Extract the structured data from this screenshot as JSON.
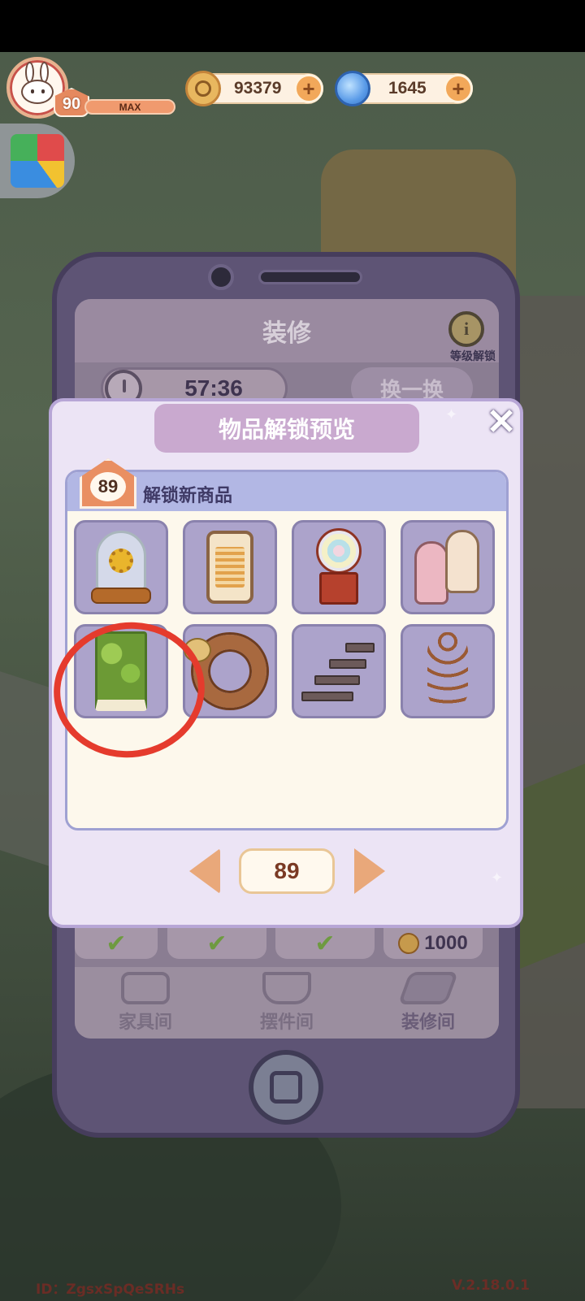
{
  "player": {
    "level": "90",
    "level_status": "MAX"
  },
  "currency": {
    "coins": "93379",
    "gems": "1645",
    "coin_icon": "coin-icon",
    "gem_icon": "swirl-gem-icon"
  },
  "renovation": {
    "title": "装修",
    "level_unlock_label": "等级解锁",
    "timer": "57:36",
    "swap_label": "换一换",
    "price": "1000"
  },
  "tabs": [
    {
      "label": "家具间",
      "icon": "sofa-icon"
    },
    {
      "label": "摆件间",
      "icon": "teacup-icon"
    },
    {
      "label": "装修间",
      "icon": "floor-tile-icon"
    }
  ],
  "modal": {
    "title": "物品解锁预览",
    "unlock_level": "89",
    "section_label": "解锁新商品",
    "page": "89",
    "items": [
      {
        "name": "sunflower-glass-dome"
      },
      {
        "name": "electric-heater"
      },
      {
        "name": "gumball-machine"
      },
      {
        "name": "paw-print-doors"
      },
      {
        "name": "hedge-wall",
        "highlighted": true
      },
      {
        "name": "ribbon-wreath"
      },
      {
        "name": "glass-staircase"
      },
      {
        "name": "wooden-chain-decor"
      }
    ]
  },
  "footer": {
    "id_text": "ID：ZgsxSpQeSRHs",
    "version": "V.2.18.0.1"
  },
  "colors": {
    "annotation_red": "#e53b2d",
    "modal_border": "#b7a6d6",
    "accent_orange": "#e98f62"
  }
}
